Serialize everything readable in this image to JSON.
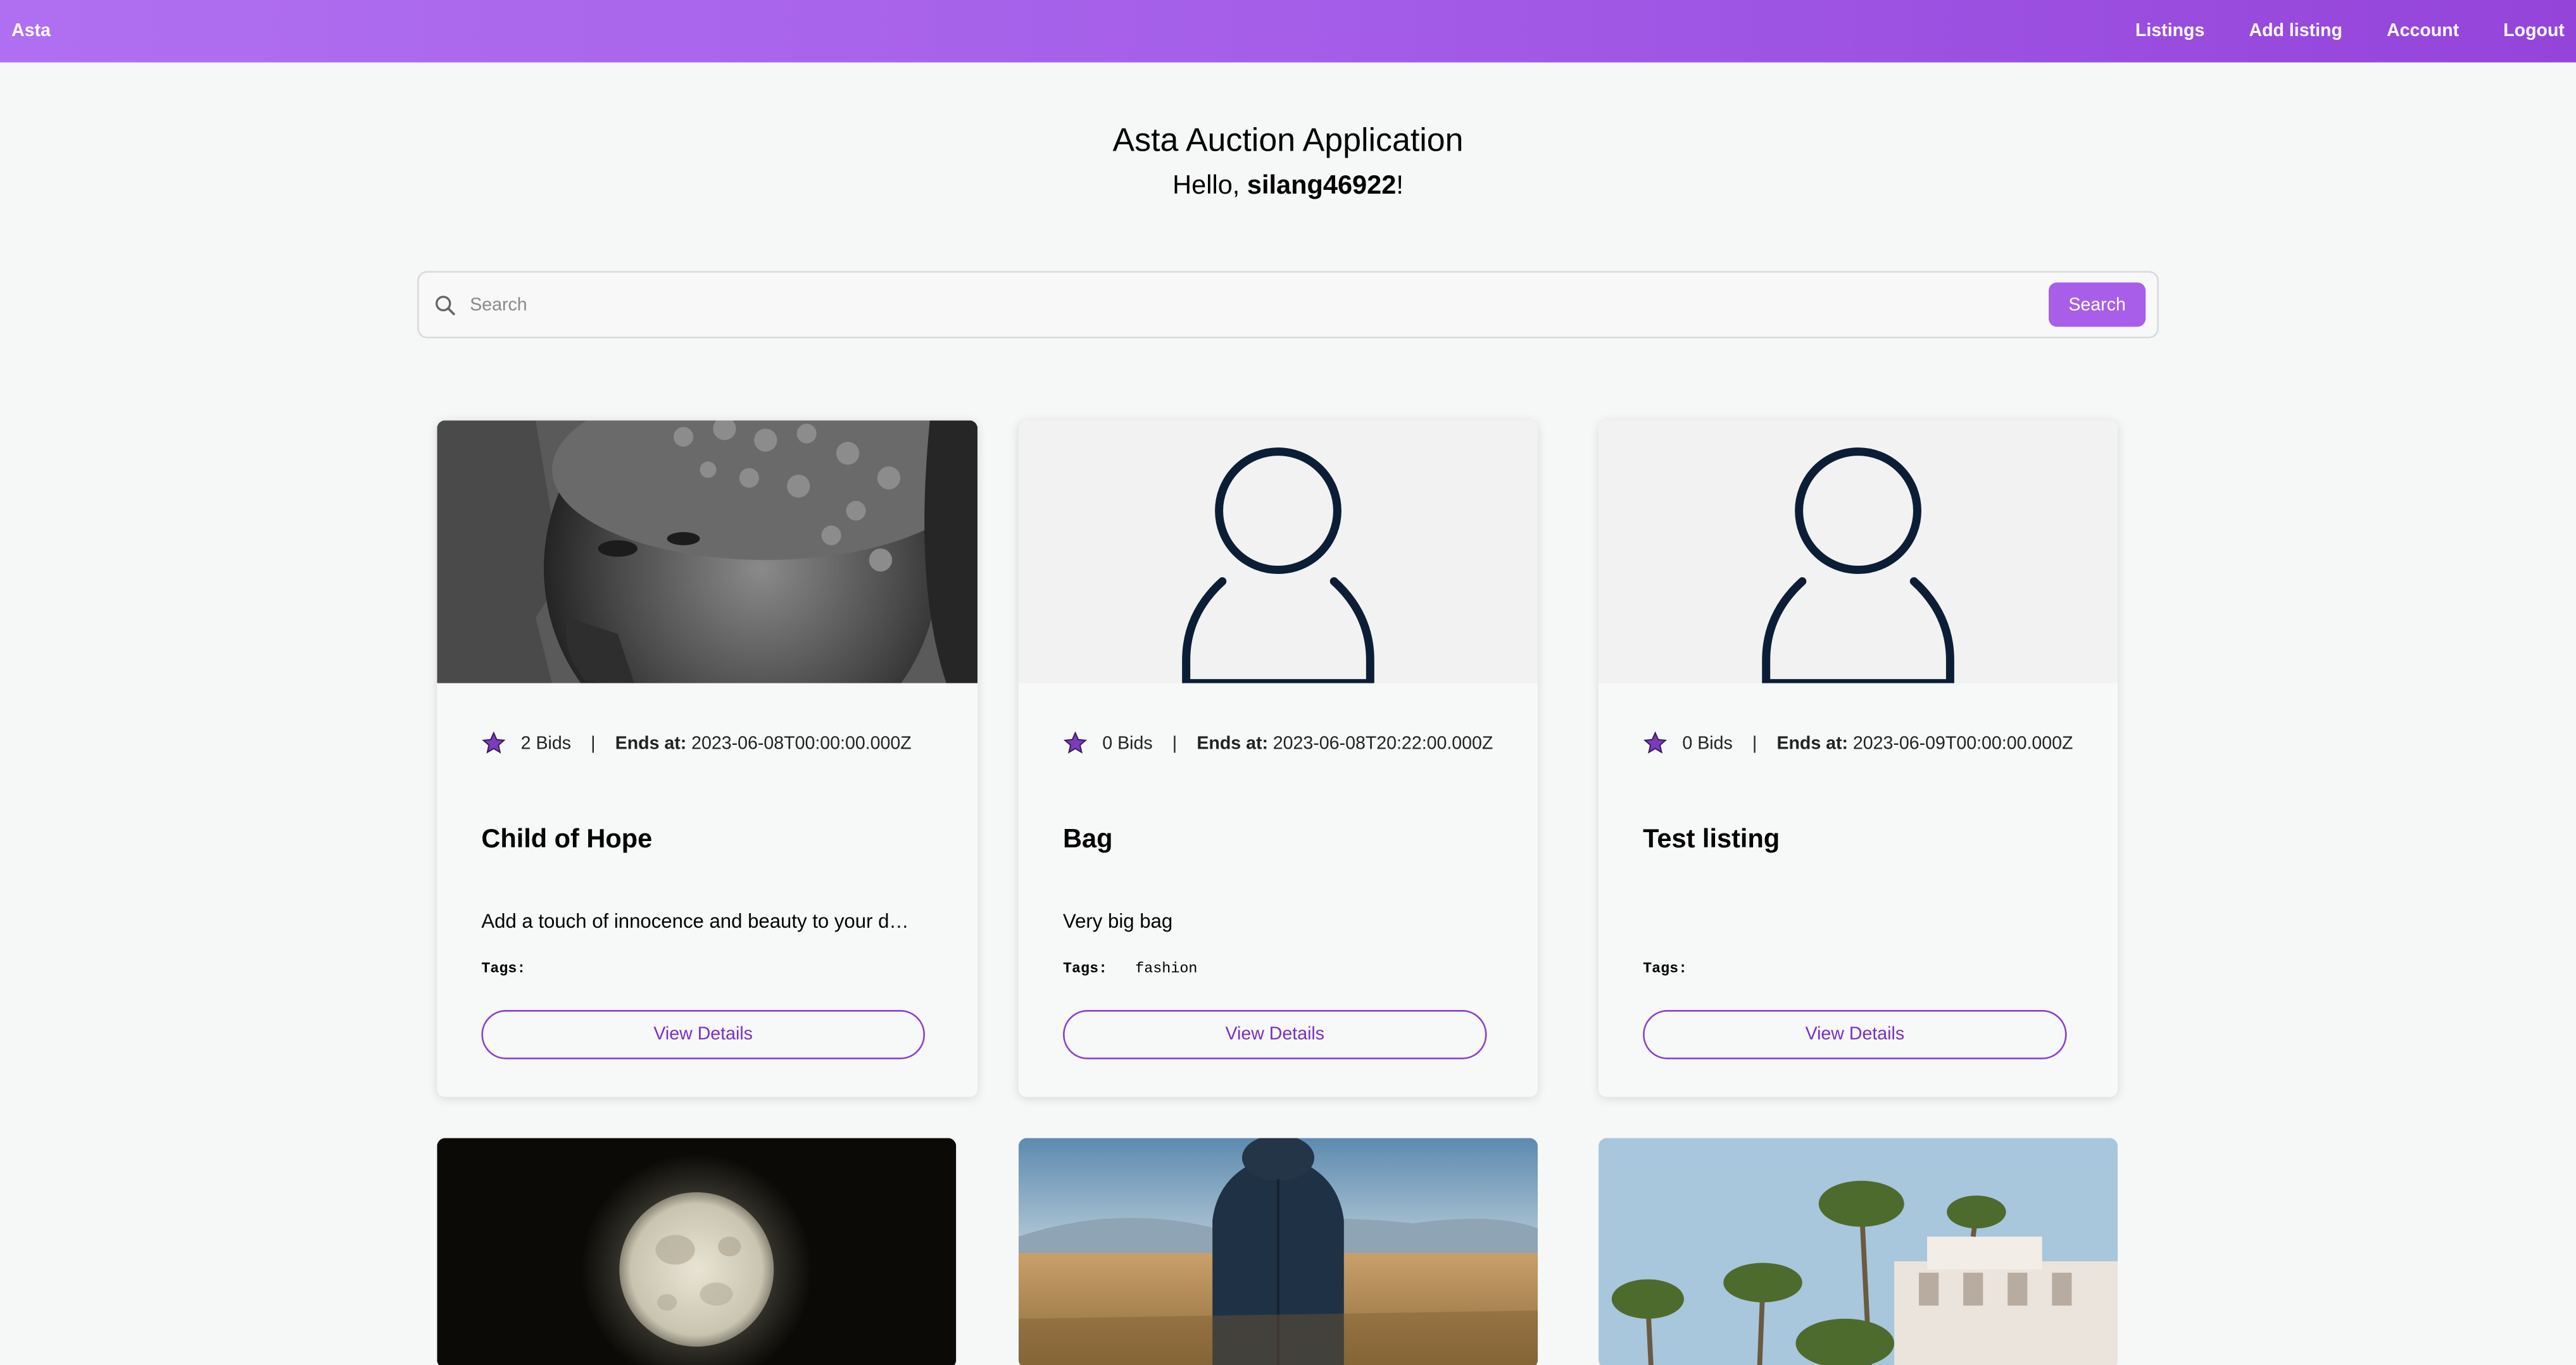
{
  "nav": {
    "brand": "Asta",
    "links": [
      "Listings",
      "Add listing",
      "Account",
      "Logout"
    ]
  },
  "header": {
    "title": "Asta Auction Application",
    "greeting_prefix": "Hello, ",
    "username": "silang46922",
    "greeting_suffix": "!"
  },
  "search": {
    "placeholder": "Search",
    "button_label": "Search"
  },
  "listings": [
    {
      "bids": "2 Bids",
      "ends_label": "Ends at:",
      "ends_at": "2023-06-08T00:00:00.000Z",
      "title": "Child of Hope",
      "description": "Add a touch of innocence and beauty to your d…",
      "tags_label": "Tags:",
      "tags": "",
      "button": "View Details",
      "image": "portrait-photo"
    },
    {
      "bids": "0 Bids",
      "ends_label": "Ends at:",
      "ends_at": "2023-06-08T20:22:00.000Z",
      "title": "Bag",
      "description": "Very big bag",
      "tags_label": "Tags:",
      "tags": "fashion",
      "button": "View Details",
      "image": "user-placeholder-icon"
    },
    {
      "bids": "0 Bids",
      "ends_label": "Ends at:",
      "ends_at": "2023-06-09T00:00:00.000Z",
      "title": "Test listing",
      "description": "",
      "tags_label": "Tags:",
      "tags": "",
      "button": "View Details",
      "image": "user-placeholder-icon"
    }
  ],
  "colors": {
    "accent": "#a85ee9",
    "nav_gradient_start": "#b06ff0",
    "nav_gradient_end": "#9544da",
    "star": "#7a3cb8"
  }
}
